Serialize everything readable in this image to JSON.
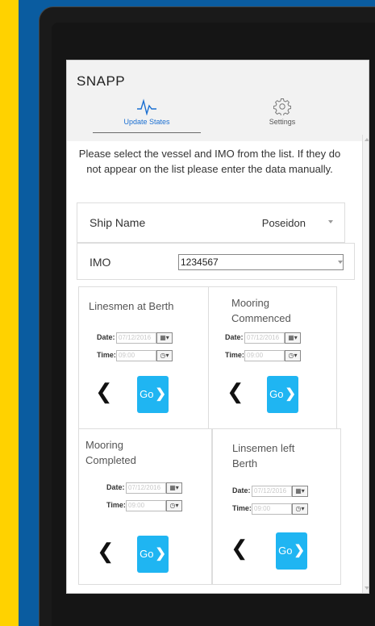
{
  "app": {
    "title": "SNAPP"
  },
  "tabs": [
    {
      "label": "Update States",
      "icon": "pulse-icon",
      "active": true
    },
    {
      "label": "Settings",
      "icon": "gear-icon",
      "active": false
    }
  ],
  "instructions": "Please select the vessel and IMO from the list. If they do not appear on the list please enter the data manually.",
  "ship": {
    "label": "Ship Name",
    "value": "Poseidon"
  },
  "imo": {
    "label": "IMO",
    "value": "1234567"
  },
  "cards": [
    {
      "title": "Linesmen at Berth",
      "date_label": "Date:",
      "date_value": "07/12/2016",
      "time_label": "Time:",
      "time_value": "09:00",
      "go_label": "Go"
    },
    {
      "title": "Mooring Commenced",
      "date_label": "Date:",
      "date_value": "07/12/2016",
      "time_label": "Time:",
      "time_value": "09:00",
      "go_label": "Go"
    },
    {
      "title": "Mooring Completed",
      "date_label": "Date:",
      "date_value": "07/12/2016",
      "time_label": "Time:",
      "time_value": "09:00",
      "go_label": "Go"
    },
    {
      "title": "Linsemen left Berth",
      "date_label": "Date:",
      "date_value": "07/12/2016",
      "time_label": "Time:",
      "time_value": "09:00",
      "go_label": "Go"
    }
  ],
  "colors": {
    "accent": "#1fb5f2",
    "tab_active": "#1b6fd1",
    "brand_yellow": "#ffd200",
    "brand_blue": "#0a5ca0"
  }
}
